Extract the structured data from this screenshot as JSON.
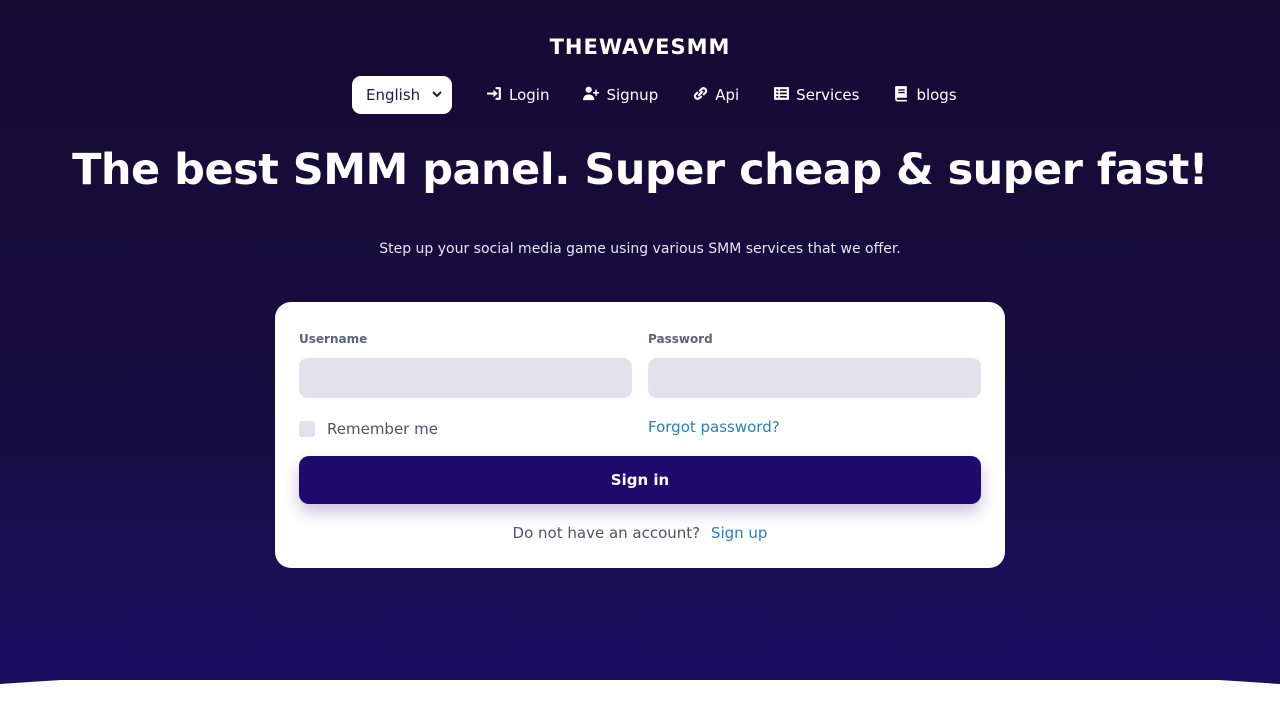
{
  "brand": "THEWAVESMM",
  "nav": {
    "language": "English",
    "items": [
      {
        "label": "Login",
        "icon": "sign-in-icon"
      },
      {
        "label": "Signup",
        "icon": "user-plus-icon"
      },
      {
        "label": "Api",
        "icon": "link-icon"
      },
      {
        "label": "Services",
        "icon": "list-icon"
      },
      {
        "label": "blogs",
        "icon": "book-icon"
      }
    ]
  },
  "hero": {
    "title": "The best SMM panel. Super cheap & super fast!",
    "subtitle": "Step up your social media game using various SMM services that we offer."
  },
  "login": {
    "username_label": "Username",
    "username_value": "",
    "password_label": "Password",
    "password_value": "",
    "remember_label": "Remember me",
    "forgot_label": "Forgot password?",
    "submit_label": "Sign in",
    "no_account_text": "Do not have an account?",
    "signup_link": "Sign up"
  },
  "colors": {
    "background": "#140c33",
    "button": "#1e0b6e",
    "link": "#2b7fc0",
    "input_bg": "#e3e1ee"
  }
}
